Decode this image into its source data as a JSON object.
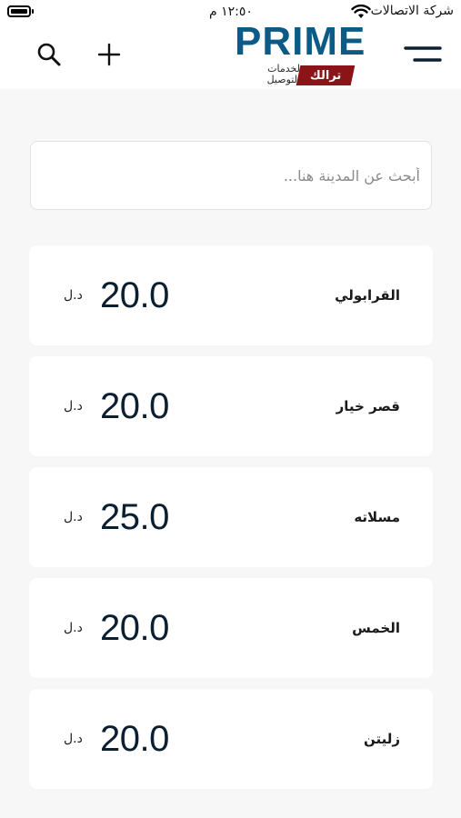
{
  "status_bar": {
    "carrier": "شركة الاتصالات",
    "time": "١٢:٥٠ م"
  },
  "header": {
    "logo_text": "PRIME",
    "logo_tagline": "لخدمات التوصيل",
    "logo_badge": "ترالك",
    "icons": [
      "search-icon",
      "plus-icon",
      "menu-icon"
    ],
    "brand_color": "#0c5a86",
    "badge_color": "#8a1418"
  },
  "search": {
    "placeholder": "أبحث عن المدينة هنا..."
  },
  "cities": [
    {
      "name": "القرابولي",
      "price": "20.0",
      "currency": "د.ل"
    },
    {
      "name": "قصر خيار",
      "price": "20.0",
      "currency": "د.ل"
    },
    {
      "name": "مسلاته",
      "price": "25.0",
      "currency": "د.ل"
    },
    {
      "name": "الخمس",
      "price": "20.0",
      "currency": "د.ل"
    },
    {
      "name": "زليتن",
      "price": "20.0",
      "currency": "د.ل"
    }
  ]
}
